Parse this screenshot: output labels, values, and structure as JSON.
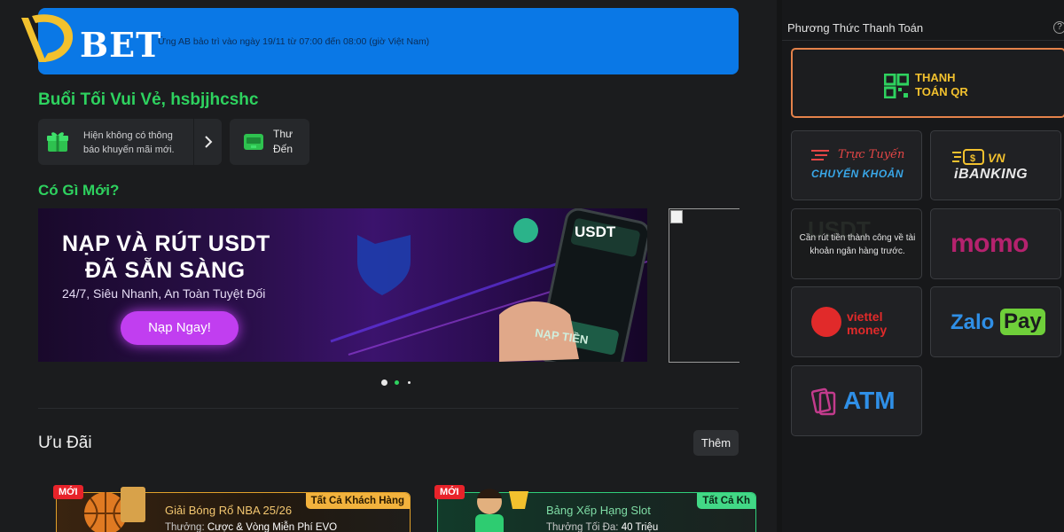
{
  "brand": {
    "logo_text": "BET"
  },
  "notice": {
    "text": "Ứng AB bảo trì vào ngày 19/11 từ 07:00 đến 08:00 (giờ Việt Nam)"
  },
  "greeting": "Buổi Tối Vui Vẻ, hsbjjhcshc",
  "promo_card": {
    "text": "Hiện không có thông báo khuyến mãi mới."
  },
  "mail_card": {
    "line1": "Thư",
    "line2": "Đến"
  },
  "whats_new": "Có Gì Mới?",
  "banner": {
    "line1": "NẠP VÀ RÚT USDT",
    "line2": "ĐÃ SẴN SÀNG",
    "subtitle": "24/7, Siêu Nhanh, An Toàn Tuyệt Đối",
    "cta": "Nạp Ngay!",
    "phone_label": "USDT",
    "phone_button": "NẠP TIỀN"
  },
  "carousel": {
    "count": 3,
    "active": 1
  },
  "offers_section": {
    "title": "Ưu Đãi",
    "more": "Thêm"
  },
  "offers": [
    {
      "tag": "MỚI",
      "label": "Tất Cả Khách Hàng",
      "title": "Giải Bóng Rổ NBA 25/26",
      "reward_prefix": "Thưởng:",
      "reward": "Cược & Vòng Miễn Phí EVO"
    },
    {
      "tag": "MỚI",
      "label": "Tất Cả Kh",
      "title": "Bảng Xếp Hạng Slot",
      "reward_prefix": "Thưởng Tối Đa:",
      "reward": "40 Triệu"
    }
  ],
  "sidebar": {
    "title": "Phương Thức Thanh Toán",
    "help": "?",
    "methods": [
      {
        "line1": "THANH",
        "line2": "TOÁN QR",
        "selected": true
      },
      {
        "line1": "Trực Tuyến",
        "line2": "CHUYỂN KHOẢN"
      },
      {
        "line1": "VN",
        "line2": "iBANKING"
      },
      {
        "bg_text": "USDT",
        "message": "Cần rút tiền thành công về tài khoản ngân hàng trước."
      },
      {
        "text": "momo"
      },
      {
        "line1": "viettel",
        "line2": "money"
      },
      {
        "text": "Zalo",
        "badge": "Pay"
      },
      {
        "text": "ATM"
      }
    ]
  },
  "colors": {
    "accent_green": "#2ed25f",
    "notice_blue": "#0a78e6",
    "qr_border": "#e4824a",
    "gold": "#f2c12e"
  }
}
